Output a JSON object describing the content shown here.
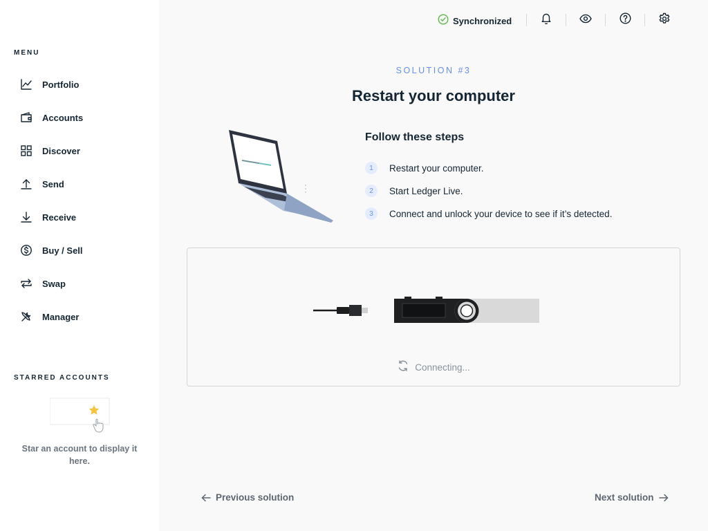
{
  "sidebar": {
    "menu_title": "MENU",
    "items": [
      {
        "label": "Portfolio",
        "icon": "chart-line-icon"
      },
      {
        "label": "Accounts",
        "icon": "wallet-icon"
      },
      {
        "label": "Discover",
        "icon": "grid-icon"
      },
      {
        "label": "Send",
        "icon": "arrow-up-icon"
      },
      {
        "label": "Receive",
        "icon": "arrow-down-icon"
      },
      {
        "label": "Buy / Sell",
        "icon": "dollar-icon"
      },
      {
        "label": "Swap",
        "icon": "swap-icon"
      },
      {
        "label": "Manager",
        "icon": "tools-icon"
      }
    ],
    "starred_title": "STARRED ACCOUNTS",
    "starred_empty_text": "Star an account to display it here."
  },
  "topbar": {
    "sync_label": "Synchronized",
    "sync_color": "#66be54"
  },
  "main": {
    "solution_label": "SOLUTION #3",
    "title": "Restart your computer",
    "steps_title": "Follow these steps",
    "steps": [
      {
        "num": "1",
        "text": "Restart your computer."
      },
      {
        "num": "2",
        "text": "Start Ledger Live."
      },
      {
        "num": "3",
        "text": "Connect and unlock your device to see if it’s detected."
      }
    ],
    "connecting_text": "Connecting...",
    "prev_label": "Previous solution",
    "next_label": "Next solution"
  },
  "colors": {
    "accent": "#6490f1",
    "text": "#142533",
    "muted": "#6b7581"
  }
}
